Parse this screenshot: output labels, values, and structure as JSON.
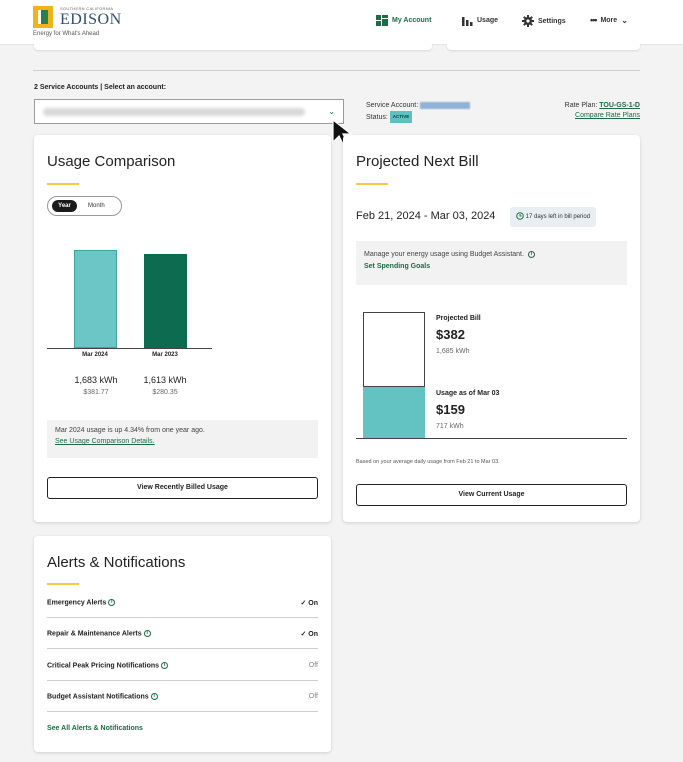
{
  "header": {
    "logo_small": "SOUTHERN CALIFORNIA",
    "logo_name": "EDISON",
    "logo_tagline": "Energy for What's Ahead",
    "nav": [
      {
        "label": "My Account",
        "icon": "dashboard-icon"
      },
      {
        "label": "Usage",
        "icon": "bar-chart-icon"
      },
      {
        "label": "Settings",
        "icon": "gear-icon"
      },
      {
        "label": "More",
        "icon": "more-dots-icon"
      }
    ]
  },
  "service": {
    "label": "2 Service Accounts | Select an account:",
    "selected_address": "1087 Baker St, UNIT A, Costa Mesa, CA 92626",
    "account_label": "Service Account:",
    "status_label": "Status:",
    "status_value": "ACTIVE",
    "rate_plan_label": "Rate Plan:",
    "rate_plan_value": "TOU-GS-1-D",
    "compare_link": "Compare Rate Plans"
  },
  "usage_comparison": {
    "title": "Usage Comparison",
    "toggle_year": "Year",
    "toggle_month": "Month",
    "bars": [
      {
        "label": "Mar 2024",
        "kwh": "1,683 kWh",
        "cost": "$381.77",
        "value": 1683,
        "color": "#6cc6c6"
      },
      {
        "label": "Mar 2023",
        "kwh": "1,613 kWh",
        "cost": "$280.35",
        "value": 1613,
        "color": "#0d6b4f"
      }
    ],
    "note": "Mar 2024 usage is up 4.34% from one year ago.",
    "note_link": "See Usage Comparison Details.",
    "button": "View Recently Billed Usage"
  },
  "projected_bill": {
    "title": "Projected Next Bill",
    "date_range": "Feb 21, 2024 - Mar 03, 2024",
    "days_left": "17 days left in bill period",
    "budget_text": "Manage your energy usage using Budget Assistant.",
    "budget_link": "Set Spending Goals",
    "projected_label": "Projected Bill",
    "projected_amount": "$382",
    "projected_kwh": "1,685 kWh",
    "usage_label": "Usage as of Mar 03",
    "usage_amount": "$159",
    "usage_kwh": "717 kWh",
    "footnote": "Based on your average daily usage from Feb 21 to Mar 03.",
    "button": "View Current Usage"
  },
  "alerts": {
    "title": "Alerts & Notifications",
    "items": [
      {
        "label": "Emergency Alerts",
        "status": "On"
      },
      {
        "label": "Repair & Maintenance Alerts",
        "status": "On"
      },
      {
        "label": "Critical Peak Pricing Notifications",
        "status": "Off"
      },
      {
        "label": "Budget Assistant Notifications",
        "status": "Off"
      }
    ],
    "see_all": "See All Alerts & Notifications"
  }
}
